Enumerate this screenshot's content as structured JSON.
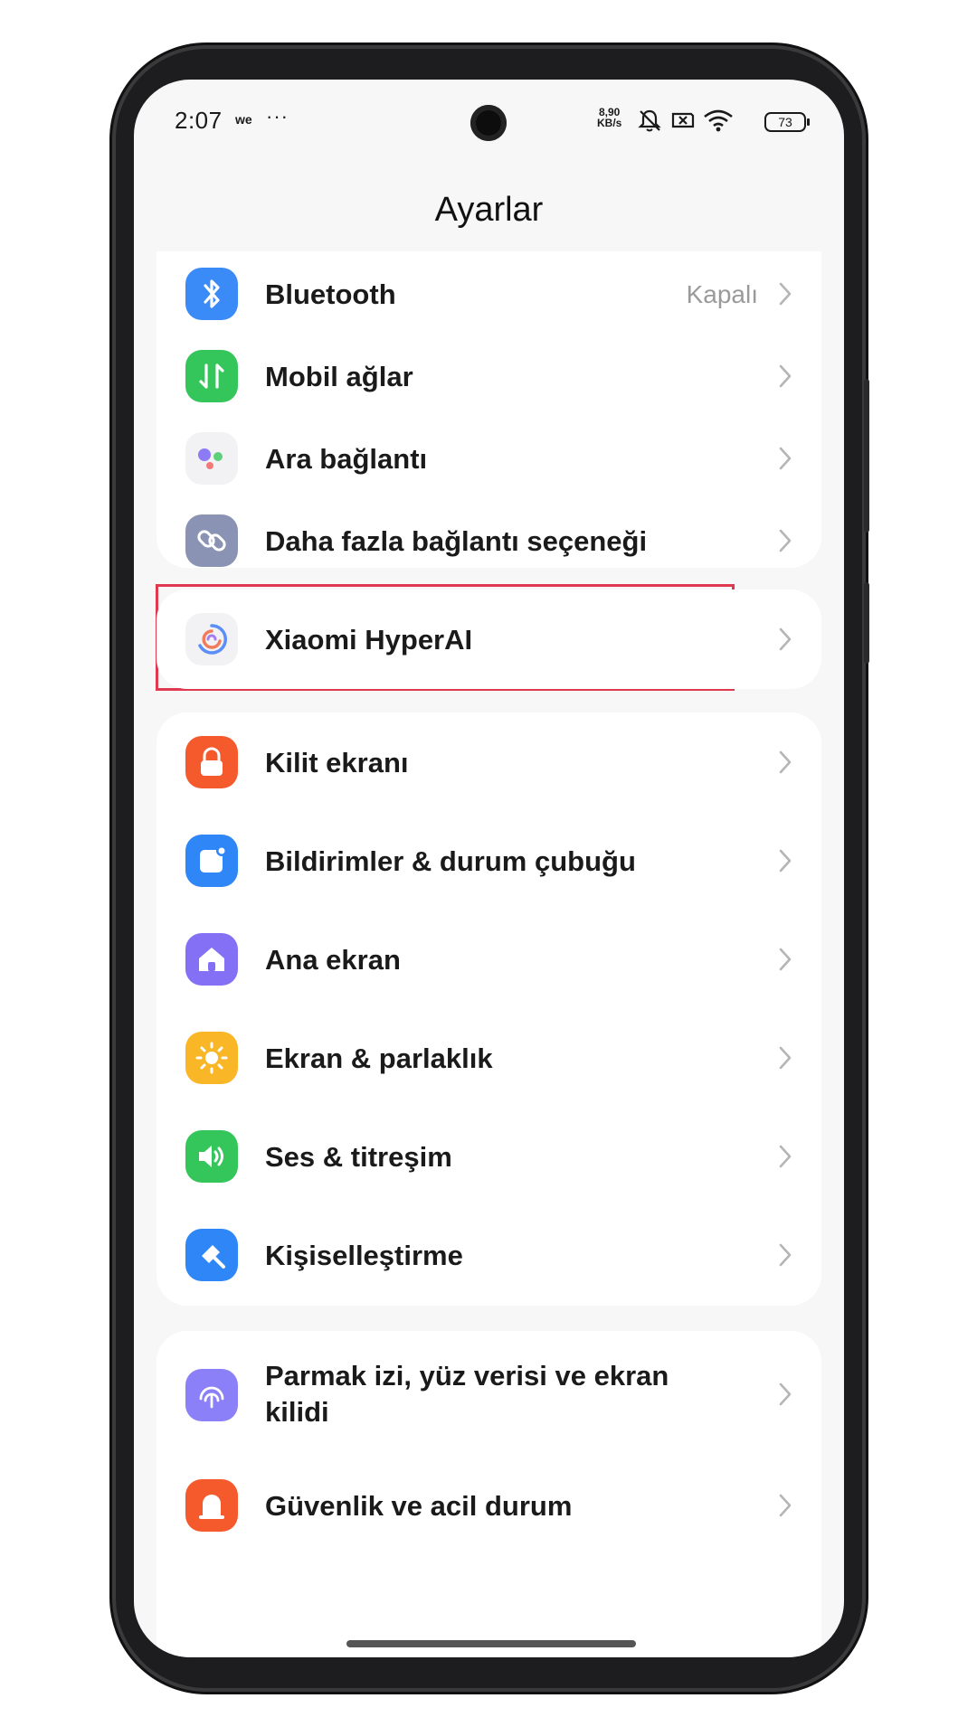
{
  "status_bar": {
    "time": "2:07",
    "carrier_mark": "we",
    "more": "···",
    "speed_value": "8,90",
    "speed_unit": "KB/s",
    "battery": "73",
    "icons": [
      "mute-icon",
      "no-sim-icon",
      "wifi-icon",
      "battery-icon"
    ]
  },
  "page": {
    "title": "Ayarlar"
  },
  "groups": [
    {
      "items": [
        {
          "label": "Bluetooth",
          "value": "Kapalı",
          "icon": "bluetooth-icon",
          "color": "#3a8bf7"
        },
        {
          "label": "Mobil ağlar",
          "icon": "mobile-data-icon",
          "color": "#34c65a"
        },
        {
          "label": "Ara bağlantı",
          "icon": "connect-dots-icon",
          "color": "#f2f2f4"
        },
        {
          "label": "Daha fazla bağlantı seçeneği",
          "icon": "link-icon",
          "color": "#8a93b3"
        }
      ]
    },
    {
      "items": [
        {
          "label": "Xiaomi HyperAI",
          "icon": "hyperai-icon",
          "color": "#f2f2f4"
        }
      ]
    },
    {
      "items": [
        {
          "label": "Kilit ekranı",
          "icon": "lock-icon",
          "color": "#f55a2c"
        },
        {
          "label": "Bildirimler & durum çubuğu",
          "icon": "notification-icon",
          "color": "#2f86f6"
        },
        {
          "label": "Ana ekran",
          "icon": "home-icon",
          "color": "#8370f5"
        },
        {
          "label": "Ekran & parlaklık",
          "icon": "sun-icon",
          "color": "#f9b626"
        },
        {
          "label": "Ses & titreşim",
          "icon": "speaker-icon",
          "color": "#34c65a"
        },
        {
          "label": "Kişiselleştirme",
          "icon": "brush-icon",
          "color": "#2f86f6"
        }
      ]
    },
    {
      "items": [
        {
          "label": "Parmak izi, yüz verisi ve ekran kilidi",
          "icon": "fingerprint-icon",
          "color": "#8b80f7"
        },
        {
          "label": "Güvenlik ve acil durum",
          "icon": "emergency-icon",
          "color": "#f55a2c"
        }
      ]
    }
  ],
  "highlight_color": "#e0384f"
}
